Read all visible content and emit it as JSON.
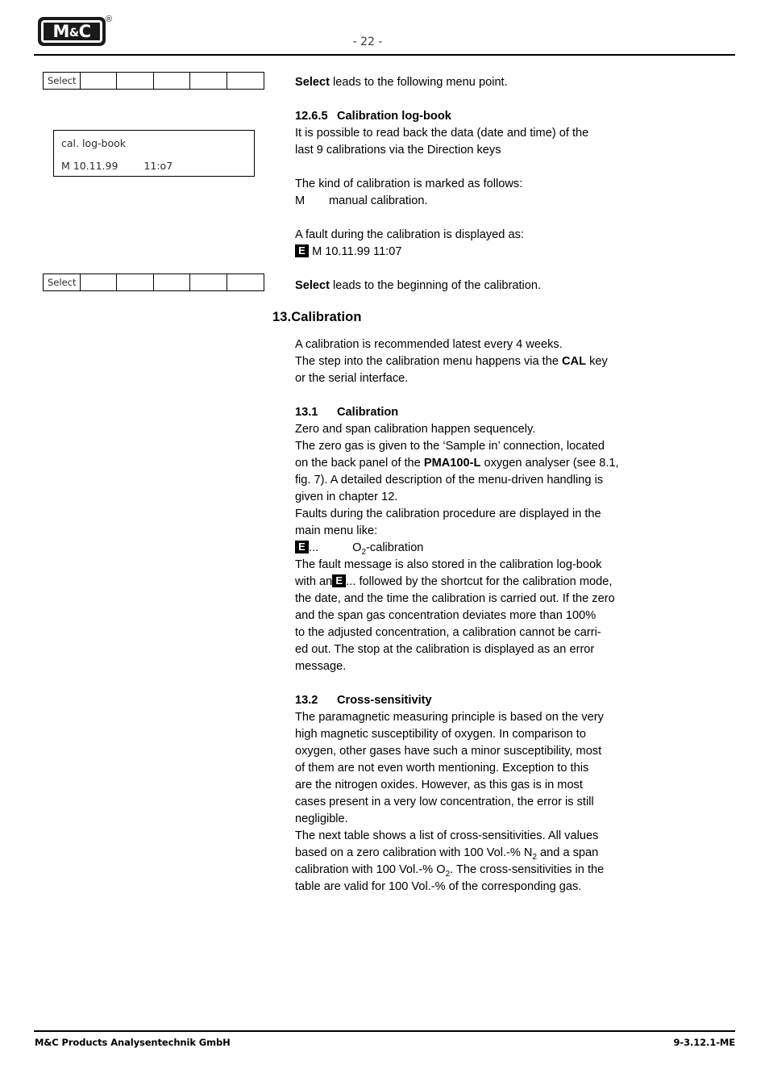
{
  "header": {
    "logo_text": "M&C",
    "logo_registered": "®",
    "page_number": "- 22 -"
  },
  "footer": {
    "company": "M&C Products Analysentechnik GmbH",
    "doc_code": "9-3.12.1-ME"
  },
  "figures": {
    "menu_bar_1": {
      "cells": [
        "Select",
        "",
        "",
        "",
        "",
        ""
      ]
    },
    "menu_bar_2": {
      "cells": [
        "Select",
        "",
        "",
        "",
        "",
        ""
      ]
    },
    "lcd_display": {
      "line1": "cal. log-book",
      "line2_mode": "M 10.11.99",
      "line2_time": "11:o7"
    }
  },
  "content": {
    "intro_select_bold": "Select",
    "intro_select_rest": " leads to the following menu point.",
    "sec_12_6_5": {
      "number": "12.6.5",
      "title": "Calibration log-book",
      "body_l1": "It is possible to read back the data (date and time) of the",
      "body_l2": "last 9 calibrations via the Direction keys"
    },
    "kind_of_calibration": "The kind of calibration is marked as follows:",
    "kind_code": "M",
    "kind_desc": "manual calibration.",
    "fault_intro": "A fault during the calibration is displayed as:",
    "fault_badge": "E",
    "fault_entry": "M  10.11.99 11:07",
    "select_begin_bold": "Select",
    "select_begin_rest": " leads to the beginning of the calibration.",
    "chapter_13": "13.Calibration",
    "chapter_13_body_l1": "A calibration is recommended latest every 4 weeks.",
    "chapter_13_body_l2a": "The step into the calibration menu happens via the ",
    "chapter_13_body_cal": "CAL",
    "chapter_13_body_l2b": " key",
    "chapter_13_body_l3": "or the serial interface.",
    "sec_13_1": {
      "number": "13.1",
      "title": "Calibration",
      "l1": "Zero and span calibration happen sequencely.",
      "l2": "The zero gas is given to the ‘Sample in’ connection, located",
      "l3a": "on the back panel of the ",
      "l3_device": "PMA100-L",
      "l3b": " oxygen analyser (see 8.1,",
      "l4": "fig. 7). A detailed description of the menu-driven handling is",
      "l5": "given in chapter 12.",
      "l6": "Faults during the calibration procedure are displayed in the",
      "l7": "main menu like:",
      "fault_badge": "E",
      "fault_dots": "...",
      "fault_label_pre": "O",
      "fault_label_sub": "2",
      "fault_label_post": "-calibration",
      "l8a": "The fault message is also stored in the calibration log-book",
      "l9a": "with an",
      "l9b": "... followed by the shortcut for the calibration mode,",
      "l10": "the date, and the time the calibration is carried out. If the zero",
      "l11": "and the span gas concentration deviates more than 100%",
      "l12": "to the adjusted concentration, a calibration cannot be carri-",
      "l13": "ed out. The stop at the calibration is displayed as an error",
      "l14": "message."
    },
    "sec_13_2": {
      "number": "13.2",
      "title": "Cross-sensitivity",
      "l1": "The paramagnetic measuring principle is based on the very",
      "l2": "high magnetic susceptibility of oxygen. In comparison to",
      "l3": "oxygen, other gases have such a minor susceptibility, most",
      "l4": "of them are not even worth mentioning. Exception to this",
      "l5": "are the nitrogen oxides. However, as this gas is in most",
      "l6": "cases present in a very low concentration, the error is still",
      "l7": "negligible.",
      "l8": "The next table shows a list of cross-sensitivities. All values",
      "l9a": "based on a zero calibration with 100 Vol.-% N",
      "l9_sub": "2",
      "l9b": " and a span",
      "l10a": "calibration with 100 Vol.-% O",
      "l10_sub": "2",
      "l10b": ". The cross-sensitivities in the",
      "l11": "table are valid for 100 Vol.-% of the corresponding gas."
    }
  }
}
